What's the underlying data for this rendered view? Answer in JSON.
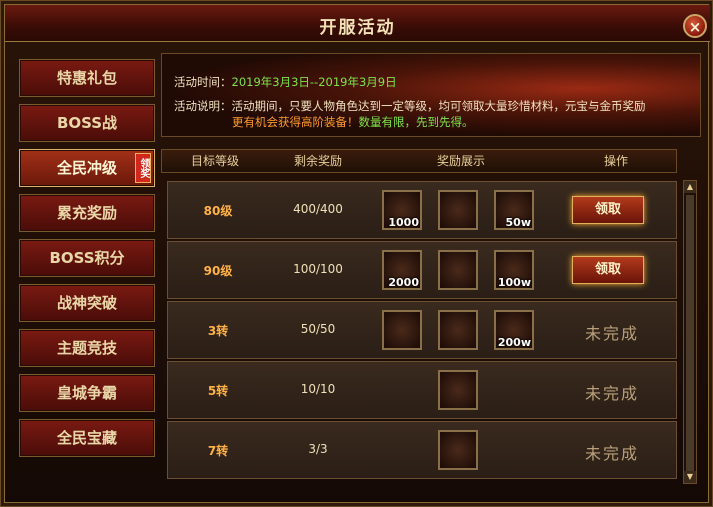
{
  "window": {
    "title": "开服活动",
    "close_label": "×"
  },
  "sidebar": {
    "items": [
      {
        "label": "特惠礼包"
      },
      {
        "label": "BOSS战"
      },
      {
        "label": "全民冲级",
        "badge": "领奖"
      },
      {
        "label": "累充奖励"
      },
      {
        "label": "BOSS积分"
      },
      {
        "label": "战神突破"
      },
      {
        "label": "主题竞技"
      },
      {
        "label": "皇城争霸"
      },
      {
        "label": "全民宝藏"
      }
    ]
  },
  "event": {
    "time_label": "活动时间：",
    "time_value": "2019年3月3日--2019年3月9日",
    "desc_label": "活动说明：",
    "desc_line1": "活动期间，只要人物角色达到一定等级，均可领取大量珍惜材料，元宝与金币奖励",
    "desc_line2a": "更有机会获得高阶装备！",
    "desc_line2b": "数量有限，先到先得。"
  },
  "table": {
    "headers": [
      "目标等级",
      "剩余奖励",
      "奖励展示",
      "操作"
    ],
    "rows": [
      {
        "level": "80级",
        "remaining": "400/400",
        "rewards": [
          {
            "icon": "gold-ingot-icon",
            "qty": "1000"
          },
          {
            "icon": "token-icon",
            "qty": ""
          },
          {
            "icon": "coin-pile-icon",
            "qty": "50w"
          }
        ],
        "action": "领取",
        "status": ""
      },
      {
        "level": "90级",
        "remaining": "100/100",
        "rewards": [
          {
            "icon": "gold-ingot-icon",
            "qty": "2000"
          },
          {
            "icon": "token-icon",
            "qty": ""
          },
          {
            "icon": "coin-pile-icon",
            "qty": "100w"
          }
        ],
        "action": "领取",
        "status": ""
      },
      {
        "level": "3转",
        "remaining": "50/50",
        "rewards": [
          {
            "icon": "armor-icon",
            "qty": ""
          },
          {
            "icon": "token-icon",
            "qty": ""
          },
          {
            "icon": "coin-pile-icon",
            "qty": "200w"
          }
        ],
        "action": "",
        "status": "未完成"
      },
      {
        "level": "5转",
        "remaining": "10/10",
        "rewards": [
          {
            "icon": "armor-icon",
            "qty": ""
          }
        ],
        "action": "",
        "status": "未完成"
      },
      {
        "level": "7转",
        "remaining": "3/3",
        "rewards": [
          {
            "icon": "sword-icon",
            "qty": ""
          }
        ],
        "action": "",
        "status": "未完成"
      }
    ]
  },
  "scrollbar": {
    "up": "▲",
    "down": "▼"
  }
}
